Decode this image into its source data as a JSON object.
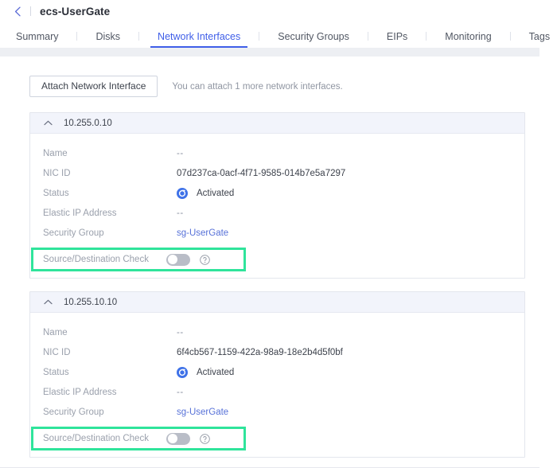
{
  "header": {
    "back_icon": "chevron-left-icon",
    "title": "ecs-UserGate"
  },
  "tabs": [
    {
      "label": "Summary",
      "active": false
    },
    {
      "label": "Disks",
      "active": false
    },
    {
      "label": "Network Interfaces",
      "active": true
    },
    {
      "label": "Security Groups",
      "active": false
    },
    {
      "label": "EIPs",
      "active": false
    },
    {
      "label": "Monitoring",
      "active": false
    },
    {
      "label": "Tags",
      "active": false
    }
  ],
  "toolbar": {
    "attach_label": "Attach Network Interface",
    "attach_hint": "You can attach 1 more network interfaces."
  },
  "labels": {
    "name": "Name",
    "nic_id": "NIC ID",
    "status": "Status",
    "elastic_ip": "Elastic IP Address",
    "security_group": "Security Group",
    "src_dst_check": "Source/Destination Check"
  },
  "icons": {
    "collapse": "chevron-up-icon",
    "status": "activated-status-icon",
    "help": "question-circle-icon",
    "toggle": "toggle-switch-off"
  },
  "colors": {
    "accent_blue": "#3f5ee8",
    "link_blue": "#5771d8",
    "highlight_green": "#2fe49b",
    "status_blue": "#3f72e8",
    "panel_header_bg": "#f2f4fb"
  },
  "interfaces": [
    {
      "ip": "10.255.0.10",
      "name": "--",
      "nic_id": "07d237ca-0acf-4f71-9585-014b7e5a7297",
      "status": "Activated",
      "elastic_ip": "--",
      "security_group": "sg-UserGate",
      "src_dst_check": "off"
    },
    {
      "ip": "10.255.10.10",
      "name": "--",
      "nic_id": "6f4cb567-1159-422a-98a9-18e2b4d5f0bf",
      "status": "Activated",
      "elastic_ip": "--",
      "security_group": "sg-UserGate",
      "src_dst_check": "off"
    }
  ]
}
